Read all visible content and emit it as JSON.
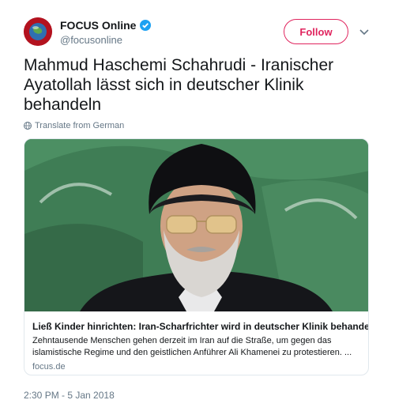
{
  "tweet": {
    "author": {
      "name": "FOCUS Online",
      "handle": "@focusonline",
      "verified": true
    },
    "follow_label": "Follow",
    "text": "Mahmud Haschemi Schahrudi - Iranischer Ayatollah lässt sich in deutscher Klinik behandeln",
    "translate_label": "Translate from German",
    "card": {
      "title": "Ließ Kinder hinrichten: Iran-Scharfrichter wird in deutscher Klinik behandelt",
      "description": "Zehntausende Menschen gehen derzeit im Iran auf die Straße, um gegen das islamistische Regime und den geistlichen Anführer Ali Khamenei zu protestieren. ...",
      "domain": "focus.de"
    },
    "timestamp": "2:30 PM - 5 Jan 2018"
  },
  "colors": {
    "follow": "#e0245e",
    "verified": "#1da1f2",
    "muted": "#657786",
    "card_bg": "#3d7a52"
  }
}
